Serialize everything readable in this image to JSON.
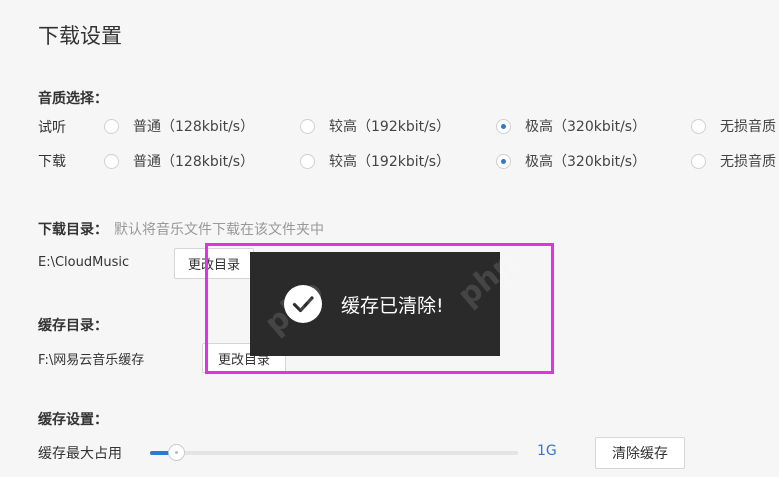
{
  "title": "下载设置",
  "quality": {
    "label": "音质选择：",
    "rows": [
      {
        "label": "试听",
        "options": [
          "普通（128kbit/s）",
          "较高（192kbit/s）",
          "极高（320kbit/s）",
          "无损音质"
        ],
        "selected": 2
      },
      {
        "label": "下载",
        "options": [
          "普通（128kbit/s）",
          "较高（192kbit/s）",
          "极高（320kbit/s）",
          "无损音质"
        ],
        "selected": 2
      }
    ]
  },
  "download_dir": {
    "label": "下载目录：",
    "hint": "默认将音乐文件下载在该文件夹中",
    "path": "E:\\CloudMusic",
    "button": "更改目录"
  },
  "cache_dir": {
    "label": "缓存目录：",
    "path": "F:\\网易云音乐缓存",
    "button": "更改目录"
  },
  "cache_settings": {
    "label": "缓存设置：",
    "max_label": "缓存最大占用",
    "value": "1G",
    "slider_fraction": 0.07,
    "clear_button": "清除缓存"
  },
  "toast": {
    "message": "缓存已清除!",
    "icon": "check-icon"
  },
  "colors": {
    "accent": "#3478c9",
    "highlight": "#e132e6",
    "toast_bg": "#2a2a2a"
  }
}
